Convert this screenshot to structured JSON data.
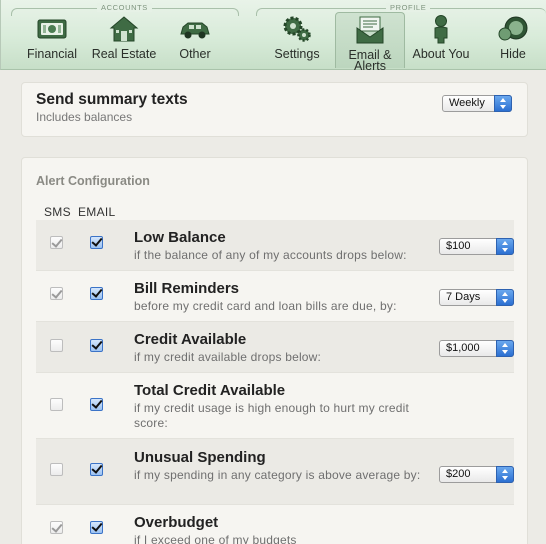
{
  "toolbar": {
    "groups": {
      "accounts": "ACCOUNTS",
      "profile": "PROFILE"
    },
    "buttons": [
      {
        "label": "Financial",
        "icon": "financial-card-icon"
      },
      {
        "label": "Real Estate",
        "icon": "house-icon"
      },
      {
        "label": "Other",
        "icon": "car-icon"
      },
      {
        "label": "Settings",
        "icon": "gears-icon"
      },
      {
        "label": "Email & Alerts",
        "icon": "envelope-icon"
      },
      {
        "label": "About You",
        "icon": "person-icon"
      },
      {
        "label": "Hide",
        "icon": "hide-icon"
      }
    ],
    "active": "Email & Alerts"
  },
  "summary": {
    "title": "Send summary texts",
    "subtitle": "Includes balances",
    "frequency": "Weekly"
  },
  "alerts": {
    "heading": "Alert Configuration",
    "col_sms": "SMS",
    "col_email": "EMAIL",
    "rows": [
      {
        "name": "Low Balance",
        "desc": "if the balance of any of my accounts drops below:",
        "sms": true,
        "email": true,
        "value": "$100"
      },
      {
        "name": "Bill Reminders",
        "desc": "before my credit card and loan bills are due, by:",
        "sms": true,
        "email": true,
        "value": "7 Days"
      },
      {
        "name": "Credit Available",
        "desc": "if my credit available drops below:",
        "sms": false,
        "email": true,
        "value": "$1,000"
      },
      {
        "name": "Total Credit Available",
        "desc": "if my credit usage is high enough to hurt my credit score:",
        "sms": false,
        "email": true,
        "value": ""
      },
      {
        "name": "Unusual Spending",
        "desc": "if my spending in any category is above average by:",
        "sms": false,
        "email": true,
        "value": "$200"
      },
      {
        "name": "Overbudget",
        "desc": "if I exceed one of my budgets",
        "sms": true,
        "email": true,
        "value": ""
      }
    ]
  },
  "colors": {
    "toolbar_green": "#d8ebd9",
    "accent_blue": "#2b6fd1"
  }
}
